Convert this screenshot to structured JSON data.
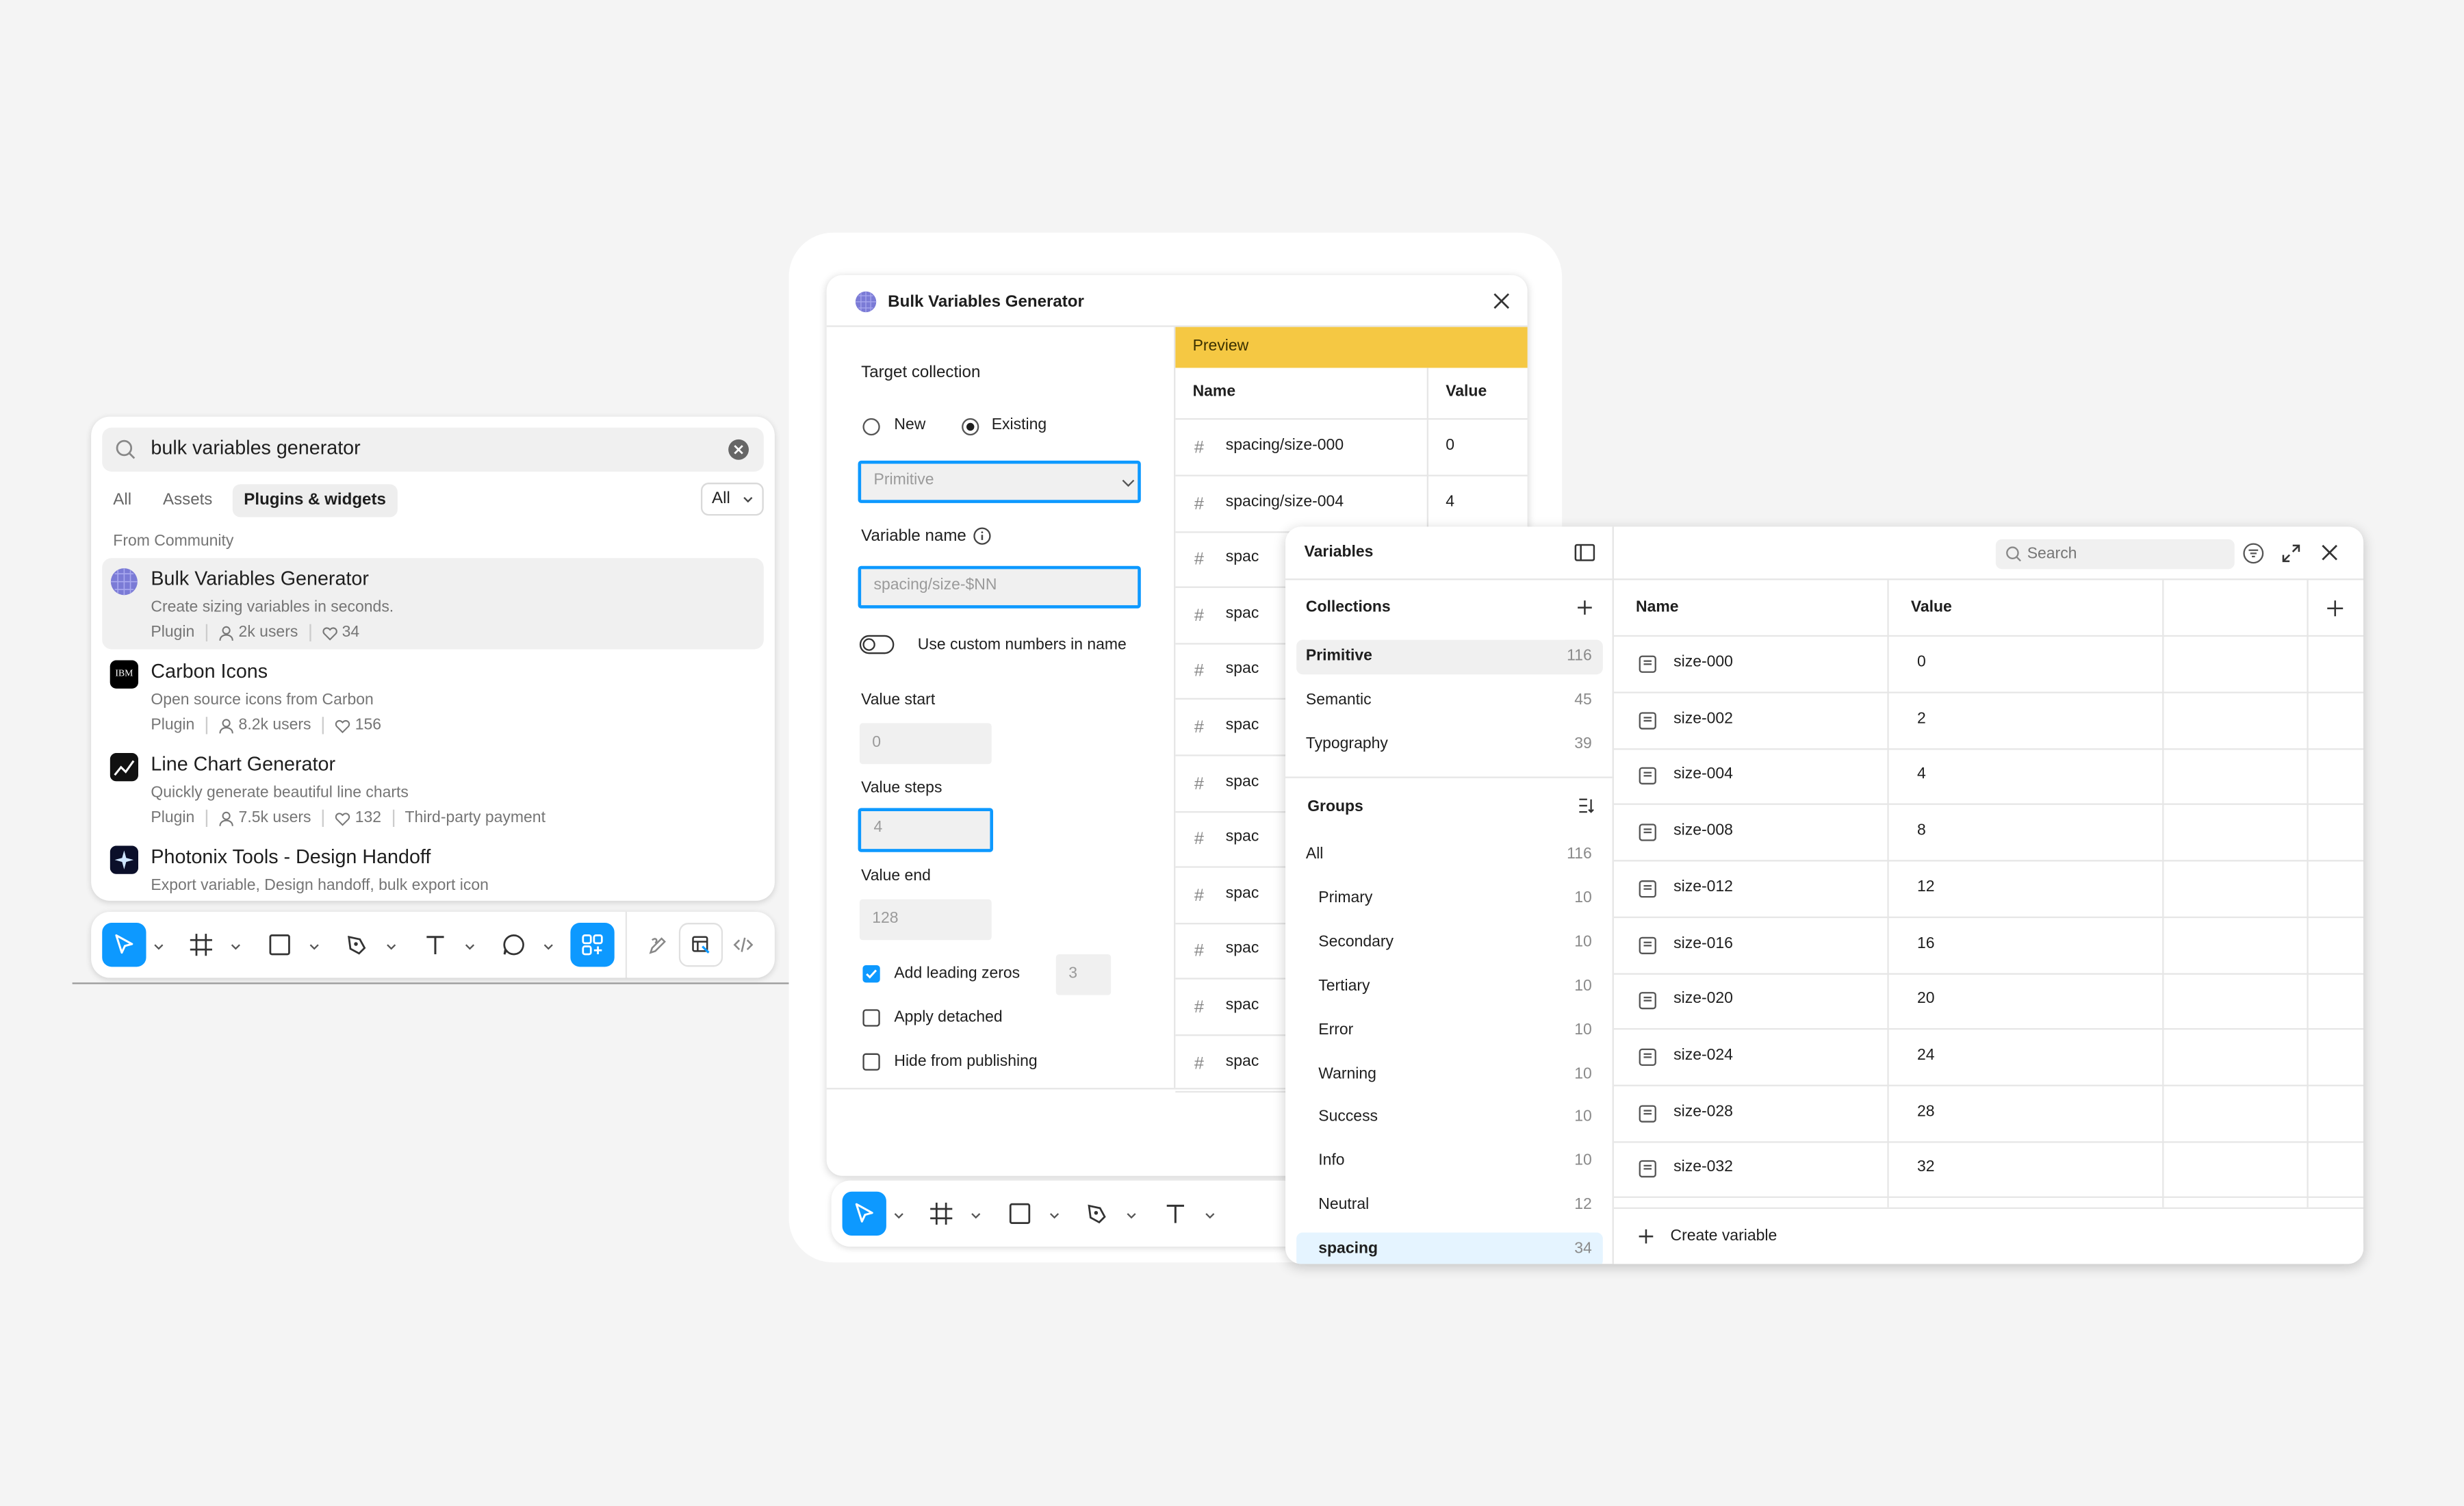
{
  "search": {
    "query": "bulk variables generator",
    "tabs": [
      "All",
      "Assets",
      "Plugins & widgets"
    ],
    "filter": "All",
    "section": "From Community",
    "results": [
      {
        "title": "Bulk Variables Generator",
        "desc": "Create sizing variables in seconds.",
        "type": "Plugin",
        "users": "2k users",
        "likes": "34",
        "extra": "",
        "icon": "globe-icon"
      },
      {
        "title": "Carbon Icons",
        "desc": "Open source icons from Carbon",
        "type": "Plugin",
        "users": "8.2k users",
        "likes": "156",
        "extra": "",
        "icon": "ibm-logo-icon"
      },
      {
        "title": "Line Chart Generator",
        "desc": "Quickly generate beautiful line charts",
        "type": "Plugin",
        "users": "7.5k users",
        "likes": "132",
        "extra": "Third-party payment",
        "icon": "line-chart-icon"
      },
      {
        "title": "Photonix Tools - Design Handoff",
        "desc": "Export variable, Design handoff, bulk export icon",
        "type": "",
        "users": "",
        "likes": "",
        "extra": "",
        "icon": "sparkle-icon"
      }
    ]
  },
  "plugin": {
    "title": "Bulk Variables Generator",
    "target_collection_label": "Target collection",
    "radio_new": "New",
    "radio_existing": "Existing",
    "collection_value": "Primitive",
    "variable_name_label": "Variable name",
    "variable_name_value": "spacing/size-$NN",
    "custom_numbers_label": "Use custom numbers in name",
    "value_start_label": "Value start",
    "value_start": "0",
    "value_steps_label": "Value steps",
    "value_steps": "4",
    "value_end_label": "Value end",
    "value_end": "128",
    "leading_zeros_label": "Add leading zeros",
    "leading_zeros_value": "3",
    "apply_detached_label": "Apply detached",
    "hide_publishing_label": "Hide from publishing",
    "preview_label": "Preview",
    "preview_col_name": "Name",
    "preview_col_value": "Value",
    "preview_rows": [
      {
        "name": "spacing/size-000",
        "value": "0"
      },
      {
        "name": "spacing/size-004",
        "value": "4"
      },
      {
        "name": "spac",
        "value": ""
      },
      {
        "name": "spac",
        "value": ""
      },
      {
        "name": "spac",
        "value": ""
      },
      {
        "name": "spac",
        "value": ""
      },
      {
        "name": "spac",
        "value": ""
      },
      {
        "name": "spac",
        "value": ""
      },
      {
        "name": "spac",
        "value": ""
      },
      {
        "name": "spac",
        "value": ""
      },
      {
        "name": "spac",
        "value": ""
      },
      {
        "name": "spac",
        "value": ""
      }
    ]
  },
  "variables": {
    "title": "Variables",
    "search_placeholder": "Search",
    "collections_label": "Collections",
    "collections": [
      {
        "name": "Primitive",
        "count": "116"
      },
      {
        "name": "Semantic",
        "count": "45"
      },
      {
        "name": "Typography",
        "count": "39"
      }
    ],
    "groups_label": "Groups",
    "groups": [
      {
        "name": "All",
        "count": "116"
      },
      {
        "name": "Primary",
        "count": "10"
      },
      {
        "name": "Secondary",
        "count": "10"
      },
      {
        "name": "Tertiary",
        "count": "10"
      },
      {
        "name": "Error",
        "count": "10"
      },
      {
        "name": "Warning",
        "count": "10"
      },
      {
        "name": "Success",
        "count": "10"
      },
      {
        "name": "Info",
        "count": "10"
      },
      {
        "name": "Neutral",
        "count": "12"
      },
      {
        "name": "spacing",
        "count": "34"
      }
    ],
    "col_name": "Name",
    "col_value": "Value",
    "rows": [
      {
        "name": "size-000",
        "value": "0"
      },
      {
        "name": "size-002",
        "value": "2"
      },
      {
        "name": "size-004",
        "value": "4"
      },
      {
        "name": "size-008",
        "value": "8"
      },
      {
        "name": "size-012",
        "value": "12"
      },
      {
        "name": "size-016",
        "value": "16"
      },
      {
        "name": "size-020",
        "value": "20"
      },
      {
        "name": "size-024",
        "value": "24"
      },
      {
        "name": "size-028",
        "value": "28"
      },
      {
        "name": "size-032",
        "value": "32"
      }
    ],
    "create_label": "Create variable"
  },
  "colors": {
    "accent": "#0d99ff",
    "preview_header": "#f5c843",
    "selected_group": "#e5f4ff"
  }
}
